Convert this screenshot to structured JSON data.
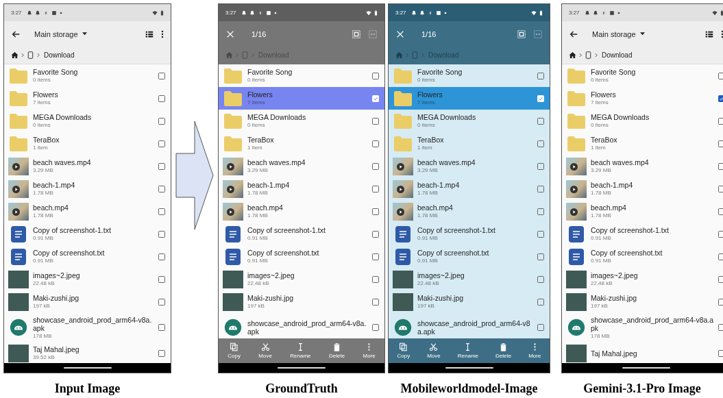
{
  "panels": [
    {
      "caption": "Input Image",
      "kind": "light",
      "status_time": "3:27",
      "toolbar": {
        "kind": "browse",
        "title": "Main storage"
      },
      "breadcrumb": "Download",
      "rows": [
        {
          "kind": "folder",
          "name": "Favorite Song",
          "detail": "0 items",
          "selected": false,
          "checked": false
        },
        {
          "kind": "folder",
          "name": "Flowers",
          "detail": "7 items",
          "selected": false,
          "checked": false
        },
        {
          "kind": "folder",
          "name": "MEGA Downloads",
          "detail": "0 items",
          "selected": false,
          "checked": false
        },
        {
          "kind": "folder",
          "name": "TeraBox",
          "detail": "1 item",
          "selected": false,
          "checked": false
        },
        {
          "kind": "video",
          "name": "beach waves.mp4",
          "detail": "3.29 MB",
          "selected": false,
          "checked": false
        },
        {
          "kind": "video",
          "name": "beach-1.mp4",
          "detail": "1.78 MB",
          "selected": false,
          "checked": false
        },
        {
          "kind": "video",
          "name": "beach.mp4",
          "detail": "1.78 MB",
          "selected": false,
          "checked": false
        },
        {
          "kind": "text",
          "name": "Copy of screenshot-1.txt",
          "detail": "0.91 MB",
          "selected": false,
          "checked": false
        },
        {
          "kind": "text",
          "name": "Copy of screenshot.txt",
          "detail": "0.91 MB",
          "selected": false,
          "checked": false
        },
        {
          "kind": "image",
          "name": "images~2.jpeg",
          "detail": "22.48 kB",
          "selected": false,
          "checked": false
        },
        {
          "kind": "image",
          "name": "Maki-zushi.jpg",
          "detail": "197 kB",
          "selected": false,
          "checked": false
        },
        {
          "kind": "apk",
          "name": "showcase_android_prod_arm64-v8a.apk",
          "detail": "178 MB",
          "selected": false,
          "checked": false
        },
        {
          "kind": "image",
          "name": "Taj Mahal.jpeg",
          "detail": "39.52 kB",
          "selected": false,
          "checked": false
        }
      ]
    },
    {
      "caption": "GroundTruth",
      "kind": "gray",
      "status_time": "3:27",
      "toolbar": {
        "kind": "selection",
        "count": "1/16"
      },
      "breadcrumb": "Download",
      "rows": [
        {
          "kind": "folder",
          "name": "Favorite Song",
          "detail": "0 items",
          "selected": false,
          "checked": false
        },
        {
          "kind": "folder",
          "name": "Flowers",
          "detail": "7 items",
          "selected": true,
          "checked": true
        },
        {
          "kind": "folder",
          "name": "MEGA Downloads",
          "detail": "0 items",
          "selected": false,
          "checked": false
        },
        {
          "kind": "folder",
          "name": "TeraBox",
          "detail": "1 item",
          "selected": false,
          "checked": false
        },
        {
          "kind": "video",
          "name": "beach waves.mp4",
          "detail": "3.29 MB",
          "selected": false,
          "checked": false
        },
        {
          "kind": "video",
          "name": "beach-1.mp4",
          "detail": "1.78 MB",
          "selected": false,
          "checked": false
        },
        {
          "kind": "video",
          "name": "beach.mp4",
          "detail": "1.78 MB",
          "selected": false,
          "checked": false
        },
        {
          "kind": "text",
          "name": "Copy of screenshot-1.txt",
          "detail": "0.91 MB",
          "selected": false,
          "checked": false
        },
        {
          "kind": "text",
          "name": "Copy of screenshot.txt",
          "detail": "0.91 MB",
          "selected": false,
          "checked": false
        },
        {
          "kind": "image",
          "name": "images~2.jpeg",
          "detail": "22.48 kB",
          "selected": false,
          "checked": false
        },
        {
          "kind": "image",
          "name": "Maki-zushi.jpg",
          "detail": "197 kB",
          "selected": false,
          "checked": false
        },
        {
          "kind": "apk",
          "name": "showcase_android_prod_arm64-v8a.apk",
          "selected": false,
          "checked": false
        }
      ],
      "actions": [
        "Copy",
        "Move",
        "Rename",
        "Delete",
        "More"
      ]
    },
    {
      "caption": "Mobileworldmodel-Image",
      "kind": "teal",
      "status_time": "3:27",
      "toolbar": {
        "kind": "selection",
        "count": "1/16"
      },
      "breadcrumb": "Download",
      "rows": [
        {
          "kind": "folder",
          "name": "Favorite Song",
          "detail": "0 items",
          "selected": false,
          "checked": false
        },
        {
          "kind": "folder",
          "name": "Flowers",
          "detail": "7 items",
          "selected": true,
          "checked": true
        },
        {
          "kind": "folder",
          "name": "MEGA Downloads",
          "detail": "0 items",
          "selected": false,
          "checked": false
        },
        {
          "kind": "folder",
          "name": "TeraBox",
          "detail": "1 item",
          "selected": false,
          "checked": false
        },
        {
          "kind": "video",
          "name": "beach waves.mp4",
          "detail": "3.29 MB",
          "selected": false,
          "checked": false
        },
        {
          "kind": "video",
          "name": "beach-1.mp4",
          "detail": "1.78 MB",
          "selected": false,
          "checked": false
        },
        {
          "kind": "video",
          "name": "beach.mp4",
          "detail": "1.78 MB",
          "selected": false,
          "checked": false
        },
        {
          "kind": "text",
          "name": "Copy of screenshot-1.txt",
          "detail": "0.91 MB",
          "selected": false,
          "checked": false
        },
        {
          "kind": "text",
          "name": "Copy of screenshot.txt",
          "detail": "0.91 MB",
          "selected": false,
          "checked": false
        },
        {
          "kind": "image",
          "name": "images~2.jpeg",
          "detail": "22.48 kB",
          "selected": false,
          "checked": false
        },
        {
          "kind": "image",
          "name": "Maki-zushi.jpg",
          "detail": "197 kB",
          "selected": false,
          "checked": false
        },
        {
          "kind": "apk",
          "name": "showcase_android_prod_arm64-v8a.apk",
          "selected": false,
          "checked": false
        }
      ],
      "actions": [
        "Copy",
        "Move",
        "Rename",
        "Delete",
        "More"
      ]
    },
    {
      "caption": "Gemini-3.1-Pro Image",
      "kind": "light",
      "status_time": "3:27",
      "toolbar": {
        "kind": "browse",
        "title": "Main storage"
      },
      "breadcrumb": "Download",
      "rows": [
        {
          "kind": "folder",
          "name": "Favorite Song",
          "detail": "0 items",
          "selected": false,
          "checked": false
        },
        {
          "kind": "folder",
          "name": "Flowers",
          "detail": "7 items",
          "selected": false,
          "checked": true
        },
        {
          "kind": "folder",
          "name": "MEGA Downloads",
          "detail": "0 items",
          "selected": false,
          "checked": false
        },
        {
          "kind": "folder",
          "name": "TeraBox",
          "detail": "1 item",
          "selected": false,
          "checked": false
        },
        {
          "kind": "video",
          "name": "beach waves.mp4",
          "detail": "3.29 MB",
          "selected": false,
          "checked": false
        },
        {
          "kind": "video",
          "name": "beach-1.mp4",
          "detail": "1.78 MB",
          "selected": false,
          "checked": false
        },
        {
          "kind": "video",
          "name": "beach.mp4",
          "detail": "1.78 MB",
          "selected": false,
          "checked": false
        },
        {
          "kind": "text",
          "name": "Copy of screenshot-1.txt",
          "detail": "0.91 MB",
          "selected": false,
          "checked": false
        },
        {
          "kind": "text",
          "name": "Copy of screenshot.txt",
          "detail": "0.91 MB",
          "selected": false,
          "checked": false
        },
        {
          "kind": "image",
          "name": "images~2.jpeg",
          "detail": "22.48 kB",
          "selected": false,
          "checked": false
        },
        {
          "kind": "image",
          "name": "Maki-zushi.jpg",
          "detail": "197 kB",
          "selected": false,
          "checked": false
        },
        {
          "kind": "apk",
          "name": "showcase_android_prod_arm64-v8a.apk",
          "detail": "178 MB",
          "selected": false,
          "checked": false
        },
        {
          "kind": "image",
          "name": "Taj Mahal.jpeg",
          "selected": false,
          "checked": false
        }
      ]
    }
  ]
}
